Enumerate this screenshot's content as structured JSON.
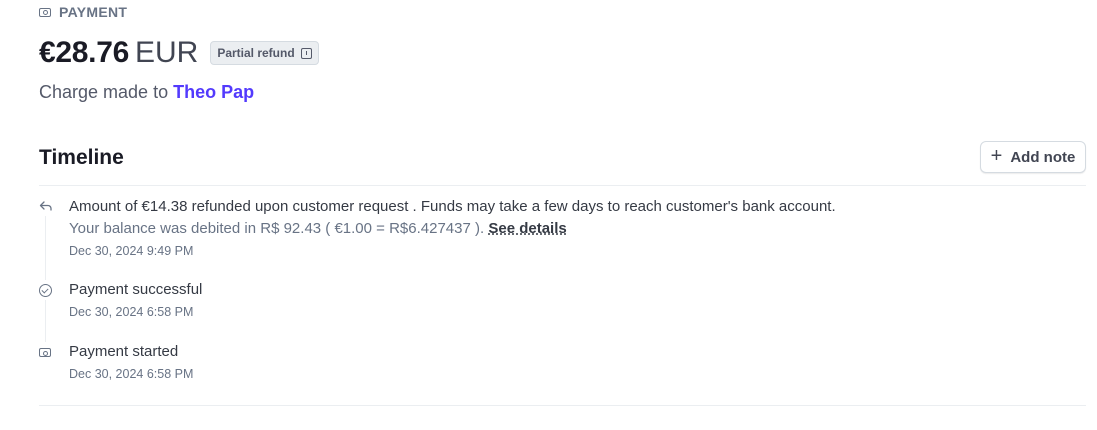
{
  "header": {
    "label": "PAYMENT",
    "icon": "money-icon"
  },
  "payment": {
    "amount": "€28.76",
    "currency": "EUR",
    "status_badge": "Partial refund",
    "charge_prefix": "Charge made to",
    "customer_name": "Theo Pap"
  },
  "timeline": {
    "title": "Timeline",
    "add_note_label": "Add note",
    "events": [
      {
        "icon": "refund-arrow-icon",
        "text": "Amount of €14.38 refunded upon customer request . Funds may take a few days to reach customer's bank account.",
        "sub_text": "Your balance was debited in R$ 92.43 ( €1.00 = R$6.427437 ).",
        "link": "See details",
        "timestamp": "Dec 30, 2024 9:49 PM"
      },
      {
        "icon": "check-circle-icon",
        "text": "Payment successful",
        "timestamp": "Dec 30, 2024 6:58 PM"
      },
      {
        "icon": "money-icon",
        "text": "Payment started",
        "timestamp": "Dec 30, 2024 6:58 PM"
      }
    ]
  },
  "colors": {
    "accent": "#533afd",
    "muted": "#687385",
    "text": "#1a1b25",
    "border": "#ebeef1"
  }
}
